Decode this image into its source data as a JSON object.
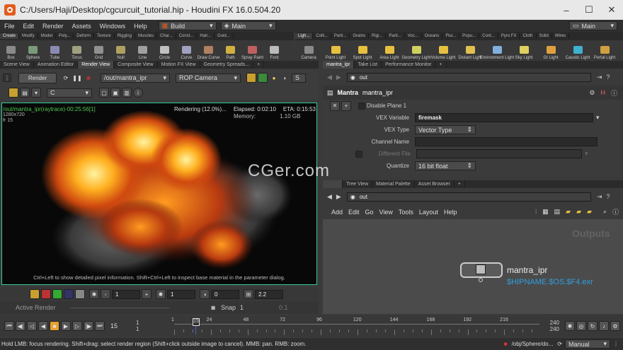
{
  "window": {
    "title": "C:/Users/Haji/Desktop/cgcurcuit_tutorial.hip - Houdini FX 16.0.504.20"
  },
  "menu": {
    "items": [
      "File",
      "Edit",
      "Render",
      "Assets",
      "Windows",
      "Help"
    ],
    "build": "Build",
    "main": "Main",
    "desktop": "Main"
  },
  "shelf_left": {
    "tabs": [
      "Create",
      "Modify",
      "Model",
      "Poly...",
      "Deform",
      "Texture",
      "Rigging",
      "Muscles",
      "Char...",
      "Const...",
      "Hair...",
      "Guid..."
    ],
    "tools": [
      "Box",
      "Sphere",
      "Tube",
      "Torus",
      "Grid",
      "Null",
      "Line",
      "Circle",
      "Curve",
      "Draw Curve",
      "Path",
      "Spray Paint",
      "Font"
    ]
  },
  "shelf_right": {
    "tabs": [
      "Ligh...",
      "Colli...",
      "Parti...",
      "Grains",
      "Rigi...",
      "Parti...",
      "Voc...",
      "Oceans",
      "Flui...",
      "Popu...",
      "Cont...",
      "Pyro FX",
      "Cloth",
      "Solid",
      "Wires"
    ],
    "tools": [
      "Camera",
      "Point Light",
      "Spot Light",
      "Area Light",
      "Geometry Light",
      "Volume Light",
      "Distant Light",
      "Environment Light",
      "Sky Light",
      "GI Light",
      "Caustic Light",
      "Portal Light"
    ]
  },
  "left_pane": {
    "tabs": [
      "Scene View",
      "Animation Editor",
      "Render View",
      "Composite View",
      "Motion FX View",
      "Geometry Spreads..."
    ],
    "render_button": "Render",
    "rop_path": "/out/mantra_ipr",
    "camera": "ROP Camera",
    "channel": "C",
    "viewport": {
      "header": "/out/mantra_ipr(raytrace)-00:25:56[1]",
      "resolution": "1280x720",
      "frame": "fr 15",
      "status": "Rendering (12.0%)...",
      "elapsed": "Elapsed: 0:02:10",
      "eta": "ETA: 0:15:53",
      "memory_label": "Memory:",
      "memory": "1.10 GB",
      "hint": "Ctrl+Left to show detailed pixel information. Shift+Ctrl+Left to inspect base material in the parameter dialog."
    },
    "bottom": {
      "v1": "1",
      "v2": "1",
      "v3": "0",
      "v4": "2.2"
    },
    "active_render": "Active Render",
    "snap": "Snap",
    "snap_val": "1",
    "snap_val2": "0.1"
  },
  "param_pane": {
    "tabs": [
      "mantra_ipr",
      "Take List",
      "Performance Monitor"
    ],
    "path": "out",
    "node_type": "Mantra",
    "node_name": "mantra_ipr",
    "rows": [
      {
        "label": "",
        "value": "Disable Plane 1"
      },
      {
        "label": "VEX Variable",
        "value": "firemask"
      },
      {
        "label": "VEX Type",
        "value": "Vector Type"
      },
      {
        "label": "Channel Name",
        "value": ""
      },
      {
        "label": "Different File",
        "value": ""
      },
      {
        "label": "Quantize",
        "value": "16 bit float"
      }
    ]
  },
  "network_pane": {
    "tabs": [
      "Tree View",
      "Material Palette",
      "Asset Browser"
    ],
    "path": "out",
    "menu": [
      "Add",
      "Edit",
      "Go",
      "View",
      "Tools",
      "Layout",
      "Help"
    ],
    "context_label": "Outputs",
    "node_name": "mantra_ipr",
    "node_output": "$HIPNAME.$OS.$F4.exr"
  },
  "playbar": {
    "frame": "15",
    "start": "1",
    "start2": "1",
    "end": "240",
    "end2": "240",
    "ticks": [
      "1",
      "24",
      "48",
      "72",
      "96",
      "120",
      "144",
      "168",
      "192",
      "216"
    ],
    "current": "15"
  },
  "status": {
    "message": "Hold LMB: focus rendering. Shift+drag: select render region (Shift+click outside image to cancel). MMB: pan. RMB: zoom.",
    "path": "/obj/Sphere/do...",
    "mode": "Manual"
  },
  "watermark": "CGer.com",
  "colors": {
    "accent": "#e25c1e",
    "render_green": "#4ec94e",
    "node_path": "#2f9fe0"
  }
}
